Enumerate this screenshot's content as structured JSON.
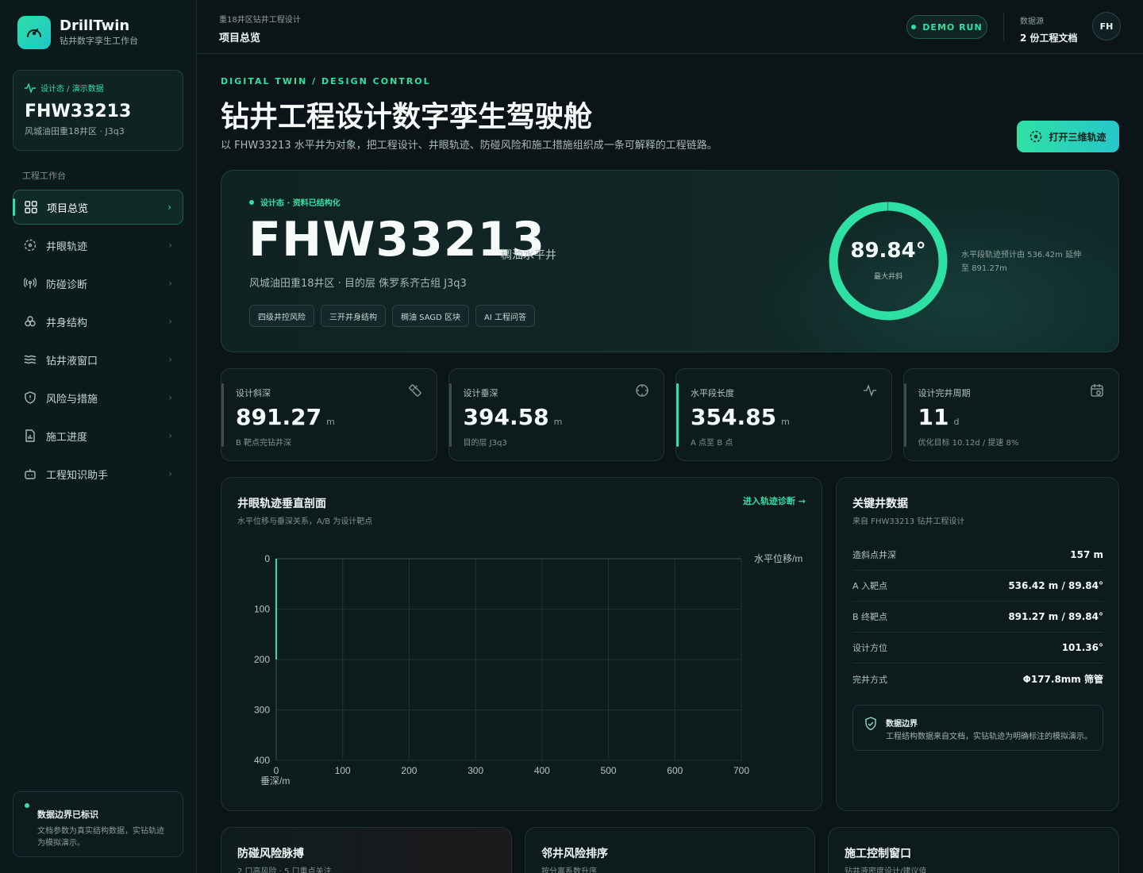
{
  "brand": {
    "title": "DrillTwin",
    "subtitle": "钻井数字孪生工作台"
  },
  "well_card": {
    "tag": "设计态 / 演示数据",
    "id": "FHW33213",
    "location": "风城油田重18井区 · J3q3"
  },
  "nav": {
    "section_label": "工程工作台",
    "items": [
      {
        "label": "项目总览",
        "icon": "grid-icon",
        "active": true
      },
      {
        "label": "井眼轨迹",
        "icon": "target-icon"
      },
      {
        "label": "防碰诊断",
        "icon": "radar-icon"
      },
      {
        "label": "井身结构",
        "icon": "layers-icon"
      },
      {
        "label": "钻井液窗口",
        "icon": "waves-icon"
      },
      {
        "label": "风险与措施",
        "icon": "shield-icon"
      },
      {
        "label": "施工进度",
        "icon": "file-chart-icon"
      },
      {
        "label": "工程知识助手",
        "icon": "bot-icon"
      }
    ]
  },
  "sidebar_notice": {
    "title": "数据边界已标识",
    "desc": "文档参数为真实结构数据，实钻轨迹为模拟演示。"
  },
  "topbar": {
    "crumb_parent": "重18井区钻井工程设计",
    "crumb_current": "项目总览",
    "demo_label": "DEMO RUN",
    "source_label": "数据源",
    "source_value": "2 份工程文档",
    "avatar": "FH"
  },
  "header": {
    "kicker": "DIGITAL TWIN / DESIGN CONTROL",
    "title": "钻井工程设计数字孪生驾驶舱",
    "lede": "以 FHW33213 水平井为对象，把工程设计、井眼轨迹、防碰风险和施工措施组织成一条可解释的工程链路。",
    "cta": "打开三维轨迹"
  },
  "hero": {
    "status": "设计态 · 资料已结构化",
    "well_id": "FHW33213",
    "well_type": "稠油水平井",
    "place": "风城油田重18井区 · 目的层 侏罗系齐古组 J3q3",
    "chips": [
      "四级井控风险",
      "三开井身结构",
      "稠油 SAGD 区块",
      "AI 工程问答"
    ],
    "gauge_value": "89.84°",
    "gauge_fraction": 0.9982,
    "gauge_label": "最大井斜",
    "gauge_note": "水平段轨迹预计由 536.42m 延伸至 891.27m"
  },
  "metrics": [
    {
      "label": "设计斜深",
      "value": "891.27",
      "unit": "m",
      "sub": "B 靶点完钻井深",
      "icon": "ruler-icon",
      "highlight": false
    },
    {
      "label": "设计垂深",
      "value": "394.58",
      "unit": "m",
      "sub": "目的层 J3q3",
      "icon": "crosshair-icon",
      "highlight": false
    },
    {
      "label": "水平段长度",
      "value": "354.85",
      "unit": "m",
      "sub": "A 点至 B 点",
      "icon": "pulse-icon",
      "highlight": true
    },
    {
      "label": "设计完井周期",
      "value": "11",
      "unit": "d",
      "sub": "优化目标 10.12d / 提速 8%",
      "icon": "calendar-icon",
      "highlight": false
    }
  ],
  "profile_panel": {
    "title": "井眼轨迹垂直剖面",
    "subtitle": "水平位移与垂深关系，A/B 为设计靶点",
    "link": "进入轨迹诊断"
  },
  "chart_data": {
    "type": "line",
    "xlabel": "水平位移/m",
    "ylabel": "垂深/m",
    "xlim": [
      0,
      700
    ],
    "ylim": [
      0,
      400
    ],
    "y_inverted": true,
    "x_ticks": [
      0,
      100,
      200,
      300,
      400,
      500,
      600,
      700
    ],
    "y_ticks": [
      0,
      100,
      200,
      300,
      400
    ],
    "grid": true,
    "series": [
      {
        "x": [
          0,
          0,
          0,
          0,
          0
        ],
        "y": [
          0,
          50,
          100,
          150,
          200
        ]
      }
    ]
  },
  "key_data": {
    "title": "关键井数据",
    "subtitle": "来自 FHW33213 钻井工程设计",
    "rows": [
      {
        "k": "造斜点井深",
        "v": "157 m"
      },
      {
        "k": "A 入靶点",
        "v": "536.42 m / 89.84°"
      },
      {
        "k": "B 终靶点",
        "v": "891.27 m / 89.84°"
      },
      {
        "k": "设计方位",
        "v": "101.36°"
      },
      {
        "k": "完井方式",
        "v": "Φ177.8mm 筛管"
      }
    ],
    "boundary_title": "数据边界",
    "boundary_desc": "工程结构数据来自文档，实钻轨迹为明确标注的模拟演示。"
  },
  "bottom_panels": [
    {
      "title": "防碰风险脉搏",
      "subtitle": "2 口高风险 · 5 口重点关注"
    },
    {
      "title": "邻井风险排序",
      "subtitle": "按分离系数升序"
    },
    {
      "title": "施工控制窗口",
      "subtitle": "钻井液密度设计/建议值"
    }
  ],
  "colors": {
    "accent": "#2fe0a4",
    "accent2": "#26c7c9",
    "bg": "#0b1416"
  }
}
